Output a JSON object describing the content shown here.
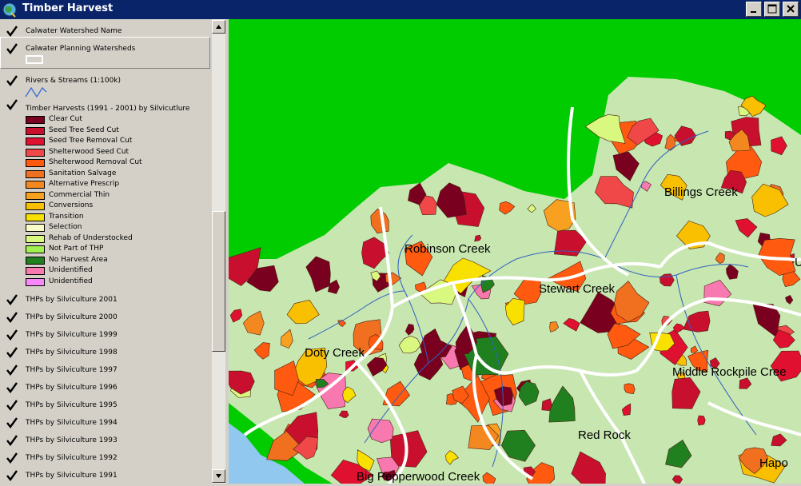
{
  "window": {
    "title": "Timber Harvest"
  },
  "layers": [
    {
      "name": "Calwater Watershed Name",
      "checked": true
    },
    {
      "name": "Calwater Planning Watersheds",
      "checked": true
    },
    {
      "name": "Rivers & Streams (1:100k)",
      "checked": true
    },
    {
      "name": "Timber Harvests (1991 - 2001) by Silvicutlure",
      "checked": true
    },
    {
      "name": "THPs by Silviculture 2001",
      "checked": true
    },
    {
      "name": "THPs by Silviculture 2000",
      "checked": true
    },
    {
      "name": "THPs by Silviculture 1999",
      "checked": true
    },
    {
      "name": "THPs by Silviculture 1998",
      "checked": true
    },
    {
      "name": "THPs by Silviculture 1997",
      "checked": true
    },
    {
      "name": "THPs by Silviculture 1996",
      "checked": true
    },
    {
      "name": "THPs by Silviculture 1995",
      "checked": true
    },
    {
      "name": "THPs by Silviculture 1994",
      "checked": true
    },
    {
      "name": "THPs by Silviculture 1993",
      "checked": true
    },
    {
      "name": "THPs by Silviculture 1992",
      "checked": true
    },
    {
      "name": "THPs by Silviculture 1991",
      "checked": true
    }
  ],
  "silviculture_classes": [
    {
      "label": "Clear Cut",
      "color": "#7a0020"
    },
    {
      "label": "Seed Tree Seed Cut",
      "color": "#c8102e"
    },
    {
      "label": "Seed Tree Removal Cut",
      "color": "#e01030"
    },
    {
      "label": "Shelterwood Seed Cut",
      "color": "#f04848"
    },
    {
      "label": "Shelterwood Removal Cut",
      "color": "#ff5a10"
    },
    {
      "label": "Sanitation Salvage",
      "color": "#f07020"
    },
    {
      "label": "Alternative Prescrip",
      "color": "#f48820"
    },
    {
      "label": "Commercial Thin",
      "color": "#f8a020"
    },
    {
      "label": "Conversions",
      "color": "#f8c000"
    },
    {
      "label": "Transition",
      "color": "#f8e000"
    },
    {
      "label": "Selection",
      "color": "#fafcc8"
    },
    {
      "label": "Rehab of Understocked",
      "color": "#d8f880"
    },
    {
      "label": "Not Part of THP",
      "color": "#a0f050"
    },
    {
      "label": "No Harvest Area",
      "color": "#208020"
    },
    {
      "label": "Unidentified",
      "color": "#f878b0"
    },
    {
      "label": "Unidentified",
      "color": "#f888f8"
    }
  ],
  "map": {
    "watershed_labels": [
      "Billings Creek",
      "Robinson Creek",
      "Stewart Creek",
      "Doty Creek",
      "Middle Rockpile Cree",
      "Red Rock",
      "Big Pepperwood Creek",
      "Hapo",
      "U"
    ],
    "colors": {
      "background": "#00cc00",
      "forest": "#c8e6b0",
      "ocean": "#90c8f0",
      "boundary": "#ffffff",
      "river": "#3060c0"
    }
  }
}
